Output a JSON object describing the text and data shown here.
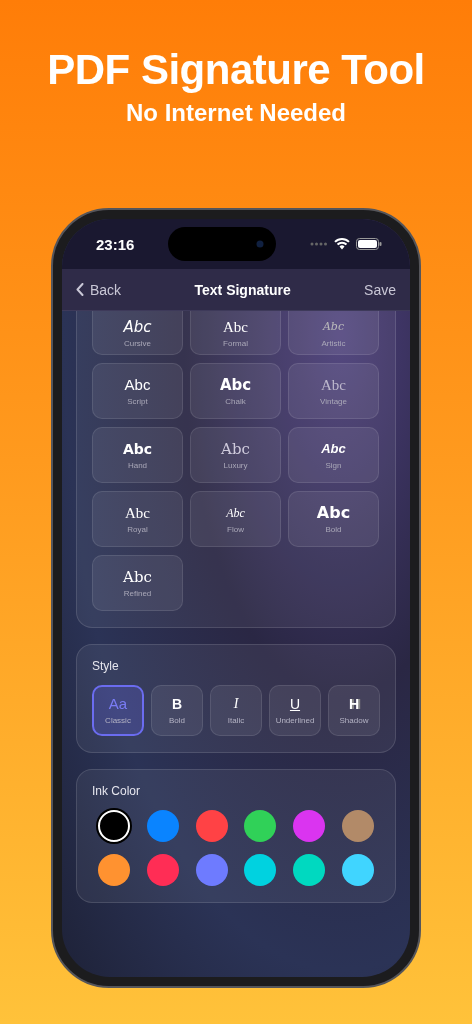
{
  "headline": "PDF Signature Tool",
  "subheadline": "No Internet Needed",
  "status_bar": {
    "time": "23:16"
  },
  "nav": {
    "back": "Back",
    "title": "Text Signature",
    "action": "Save"
  },
  "fonts": [
    {
      "kind": "cursive",
      "sample": "Abc",
      "label": "Cursive"
    },
    {
      "kind": "formal",
      "sample": "Abc",
      "label": "Formal"
    },
    {
      "kind": "artistic",
      "sample": "Abc",
      "label": "Artistic"
    },
    {
      "kind": "script",
      "sample": "Abc",
      "label": "Script"
    },
    {
      "kind": "chalk",
      "sample": "Abc",
      "label": "Chalk"
    },
    {
      "kind": "vintage",
      "sample": "Abc",
      "label": "Vintage"
    },
    {
      "kind": "hand",
      "sample": "Abc",
      "label": "Hand"
    },
    {
      "kind": "luxury",
      "sample": "Abc",
      "label": "Luxury"
    },
    {
      "kind": "sign",
      "sample": "Abc",
      "label": "Sign"
    },
    {
      "kind": "royal",
      "sample": "Abc",
      "label": "Royal"
    },
    {
      "kind": "flow",
      "sample": "Abc",
      "label": "Flow"
    },
    {
      "kind": "bold",
      "sample": "Abc",
      "label": "Bold"
    },
    {
      "kind": "refined",
      "sample": "Abc",
      "label": "Refined"
    }
  ],
  "style": {
    "title": "Style",
    "options": [
      {
        "icon": "Aa",
        "label": "Classic",
        "selected": true
      },
      {
        "icon": "B",
        "label": "Bold",
        "selected": false
      },
      {
        "icon": "I",
        "label": "Italic",
        "selected": false
      },
      {
        "icon": "U",
        "label": "Underlined",
        "selected": false
      },
      {
        "icon": "H",
        "label": "Shadow",
        "selected": false
      }
    ]
  },
  "ink": {
    "title": "Ink Color",
    "colors": [
      {
        "color": "#000000",
        "selected": true
      },
      {
        "color": "#0a84ff",
        "selected": false
      },
      {
        "color": "#ff4245",
        "selected": false
      },
      {
        "color": "#30d158",
        "selected": false
      },
      {
        "color": "#da34f0",
        "selected": false
      },
      {
        "color": "#b28a68",
        "selected": false
      },
      {
        "color": "#ff9230",
        "selected": false
      },
      {
        "color": "#ff2d55",
        "selected": false
      },
      {
        "color": "#6e7bff",
        "selected": false
      },
      {
        "color": "#00d2e0",
        "selected": false
      },
      {
        "color": "#00d9c0",
        "selected": false
      },
      {
        "color": "#40d5ff",
        "selected": false
      }
    ]
  }
}
